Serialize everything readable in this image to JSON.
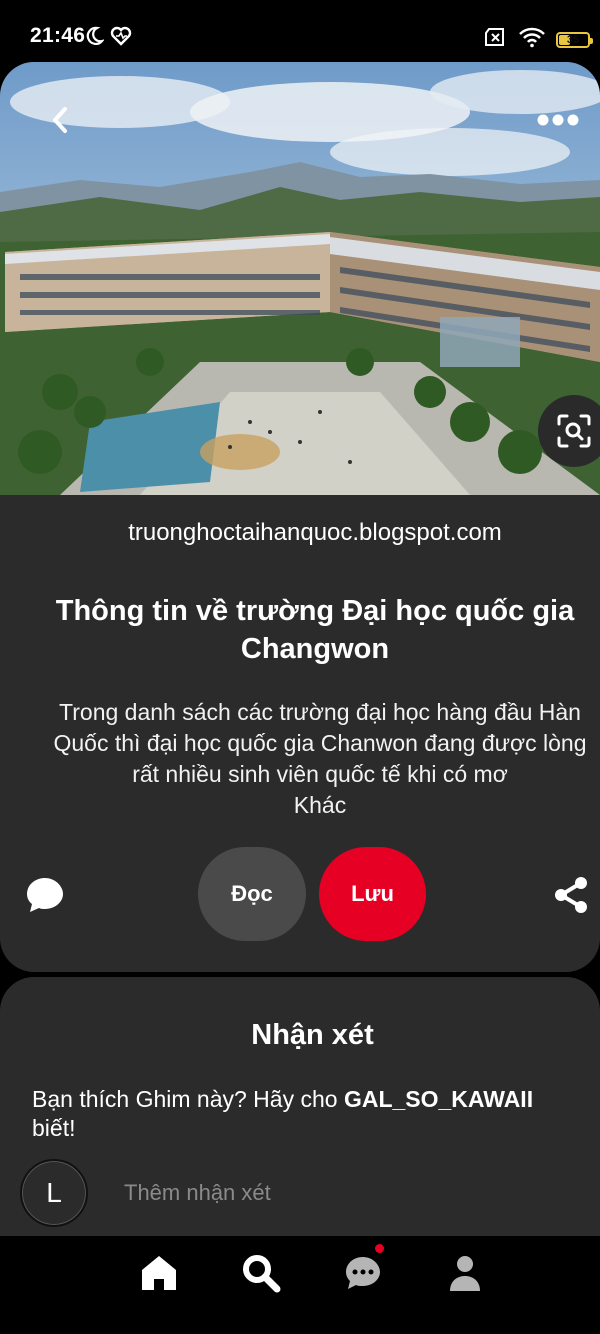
{
  "status_bar": {
    "time": "21:46",
    "icons": [
      "moon-icon",
      "health-heart-icon",
      "no-sim-icon",
      "wifi-icon",
      "battery-icon"
    ],
    "battery_level": "35",
    "battery_color": "#e8c640"
  },
  "pin": {
    "source_domain": "truonghoctaihanquoc.blogspot.com",
    "title": "Thông tin về trường Đại học quốc gia Changwon",
    "description": "Trong danh sách các trường đại học hàng đầu Hàn Quốc thì đại học quốc gia Chanwon đang được lòng rất nhiều sinh viên quốc tế khi có mơ",
    "more_label": "Khác",
    "read_label": "Đọc",
    "save_label": "Lưu",
    "save_color": "#e60023"
  },
  "comments": {
    "title": "Nhận xét",
    "prompt_prefix": "Bạn thích Ghim này? Hãy cho ",
    "prompt_user": "GAL_SO_KAWAII",
    "prompt_suffix": " biết!",
    "avatar_letter": "L",
    "input_placeholder": "Thêm nhận xét"
  },
  "bottom_nav": {
    "items": [
      "home-icon",
      "search-icon",
      "messages-icon",
      "profile-icon"
    ],
    "active": "search-icon",
    "notification_color": "#e60023"
  }
}
